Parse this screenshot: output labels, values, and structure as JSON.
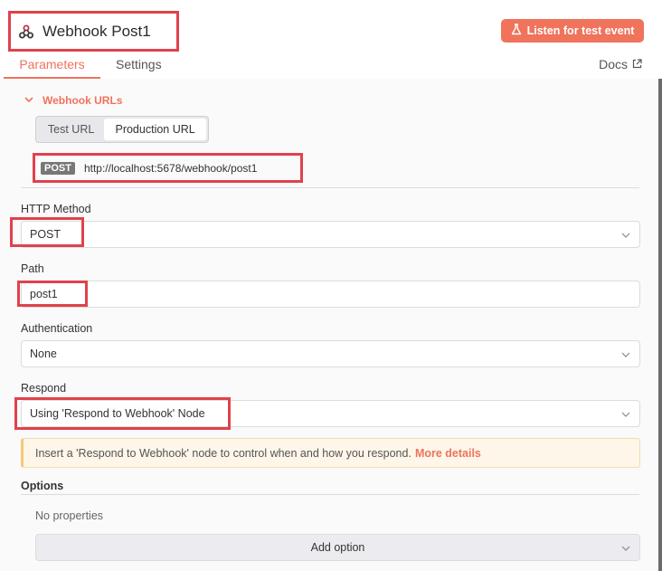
{
  "header": {
    "title": "Webhook Post1",
    "listen_label": "Listen for test event"
  },
  "tabs": [
    {
      "label": "Parameters",
      "active": true
    },
    {
      "label": "Settings",
      "active": false
    }
  ],
  "docs_label": "Docs",
  "webhook_urls": {
    "label": "Webhook URLs",
    "toggle": {
      "test_label": "Test URL",
      "production_label": "Production URL",
      "selected": "Production URL"
    },
    "method_badge": "POST",
    "url": "http://localhost:5678/webhook/post1"
  },
  "fields": {
    "http_method": {
      "label": "HTTP Method",
      "value": "POST"
    },
    "path": {
      "label": "Path",
      "value": "post1"
    },
    "authentication": {
      "label": "Authentication",
      "value": "None"
    },
    "respond": {
      "label": "Respond",
      "value": "Using 'Respond to Webhook' Node"
    }
  },
  "notice": {
    "text": "Insert a 'Respond to Webhook' node to control when and how you respond.",
    "link": "More details"
  },
  "options": {
    "label": "Options",
    "empty_text": "No properties",
    "add_label": "Add option"
  },
  "colors": {
    "accent": "#f0735c",
    "highlight": "#e0424b"
  }
}
